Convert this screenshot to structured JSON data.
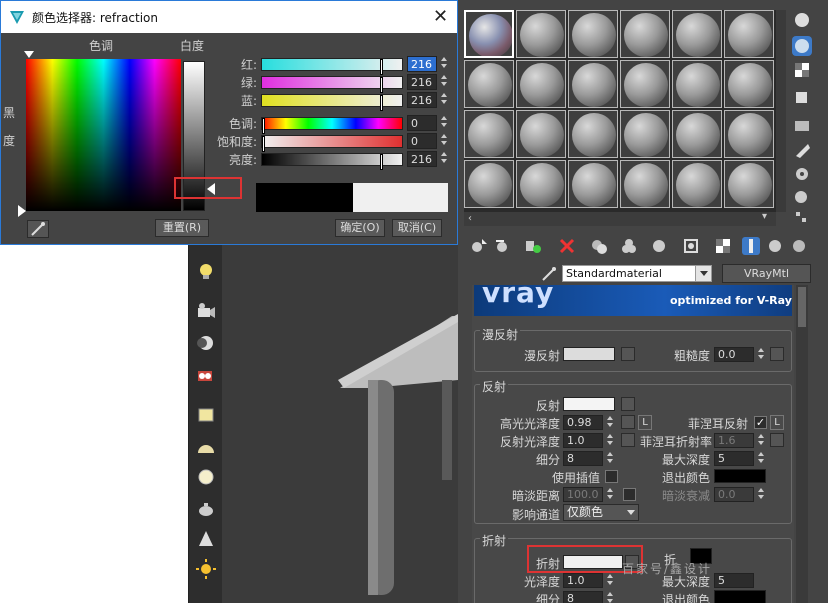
{
  "dialog": {
    "title": "颜色选择器: refraction",
    "hue_label": "色调",
    "white_label": "白度",
    "black_label": "黑度",
    "sliders": [
      {
        "label": "红:",
        "value": "216",
        "selected": true
      },
      {
        "label": "绿:",
        "value": "216",
        "selected": false
      },
      {
        "label": "蓝:",
        "value": "216",
        "selected": false
      },
      {
        "label": "色调:",
        "value": "0",
        "selected": false
      },
      {
        "label": "饱和度:",
        "value": "0",
        "selected": false
      },
      {
        "label": "亮度:",
        "value": "216",
        "selected": false
      }
    ],
    "reset_label": "重置(R)",
    "ok_label": "确定(O)",
    "cancel_label": "取消(C)",
    "colors": {
      "old_swatch": "#000000",
      "new_swatch": "#f0f0f0",
      "highlight": "#dd3333"
    }
  },
  "material": {
    "name": "Standardmaterial",
    "type": "VRayMtl",
    "banner_logo": "vray",
    "banner_sub": "optimized for V-Ray"
  },
  "diffuse": {
    "title": "漫反射",
    "diffuse_label": "漫反射",
    "roughness_label": "粗糙度",
    "roughness_value": "0.0"
  },
  "reflection": {
    "title": "反射",
    "reflect_label": "反射",
    "hilight_gloss_label": "高光光泽度",
    "hilight_gloss_value": "0.98",
    "fresnel_label": "菲涅耳反射",
    "l_label": "L",
    "refl_gloss_label": "反射光泽度",
    "refl_gloss_value": "1.0",
    "fresnel_ior_label": "菲涅耳折射率",
    "fresnel_ior_value": "1.6",
    "subdivs_label": "细分",
    "subdivs_value": "8",
    "max_depth_label": "最大深度",
    "max_depth_value": "5",
    "use_interp_label": "使用插值",
    "exit_color_label": "退出颜色",
    "dim_dist_label": "暗淡距离",
    "dim_dist_value": "100.0",
    "dim_falloff_label": "暗淡衰减",
    "dim_falloff_value": "0.0",
    "affect_channels_label": "影响通道",
    "affect_channels_value": "仅颜色"
  },
  "refraction": {
    "title": "折射",
    "refract_label": "折射",
    "gloss_label": "光泽度",
    "gloss_value": "1.0",
    "max_depth_label": "最大深度",
    "max_depth_value": "5",
    "subdivs_label": "细分",
    "subdivs_value": "8",
    "exit_color_label": "退出颜色",
    "ior_label": "折",
    "watermark": "百家号/鑫设计"
  }
}
